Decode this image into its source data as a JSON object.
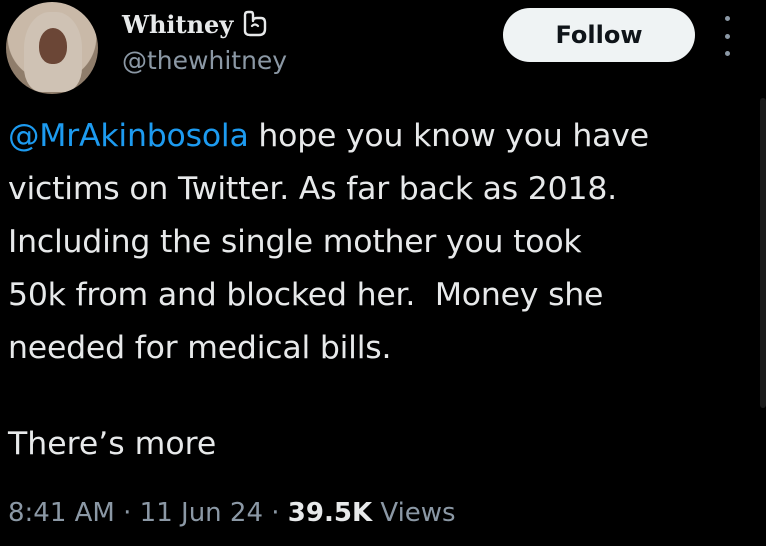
{
  "tweet": {
    "author": {
      "display_name": "Whitney",
      "handle": "@thewhitney",
      "badge_icon": "loop-badge-icon"
    },
    "follow_label": "Follow",
    "more_icon": "more-vertical-icon",
    "mention": "@MrAkinbosola",
    "text_after_mention": " hope you know you have\nvictims on Twitter. As far back as 2018.\nIncluding the single mother you took\n50k from and blocked her.  Money she\nneeded for medical bills.",
    "extra_paragraph": "There’s more",
    "meta": {
      "time": "8:41 AM",
      "separator": " · ",
      "date": "11 Jun 24",
      "views_count": "39.5K",
      "views_label": " Views"
    }
  },
  "colors": {
    "background": "#000000",
    "primary_text": "#e7e9ea",
    "secondary_text": "#8b98a5",
    "mention": "#1d9bf0",
    "follow_button_bg": "#eff3f4",
    "follow_button_text": "#0f1419"
  }
}
